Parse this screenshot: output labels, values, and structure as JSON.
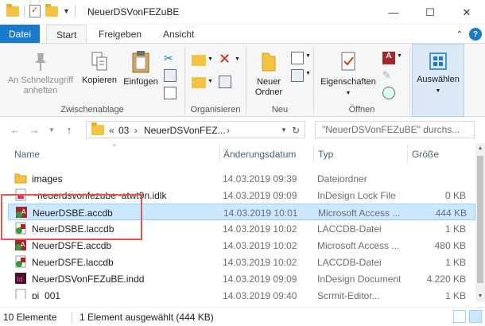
{
  "window": {
    "title": "NeuerDSVonFEZuBE",
    "minimize": "—",
    "maximize": "☐",
    "close": "✕"
  },
  "ribbon_tabs": [
    {
      "label": "Datei"
    },
    {
      "label": "Start",
      "active": true
    },
    {
      "label": "Freigeben"
    },
    {
      "label": "Ansicht"
    }
  ],
  "ribbon": {
    "zwischenablage": {
      "label": "Zwischenablage",
      "pin_label_1": "An Schnellzugriff",
      "pin_label_2": "anheften",
      "copy": "Kopieren",
      "paste": "Einfügen"
    },
    "organisieren": {
      "label": "Organisieren"
    },
    "neu": {
      "label": "Neu",
      "new_folder_1": "Neuer",
      "new_folder_2": "Ordner"
    },
    "oeffnen": {
      "label": "Öffnen",
      "properties": "Eigenschaften"
    },
    "auswaehlen": {
      "label": "Auswählen"
    }
  },
  "address": {
    "overflow": "«",
    "crumbs": [
      "03",
      "NeuerDSVonFEZ..."
    ],
    "separator": "›",
    "search_placeholder": "\"NeuerDSVonFEZuBE\" durchs..."
  },
  "columns": {
    "name": "Name",
    "date": "Änderungsdatum",
    "type": "Typ",
    "size": "Größe"
  },
  "files": [
    {
      "name": "images",
      "date": "14.03.2019 09:39",
      "type": "Dateiordner",
      "size": "",
      "icon": "folder"
    },
    {
      "name": "~neuerdsvonfezube~atwt9n.idlk",
      "date": "14.03.2019 09:09",
      "type": "InDesign Lock File",
      "size": "0 KB",
      "icon": "lock"
    },
    {
      "name": "NeuerDSBE.accdb",
      "date": "14.03.2019 10:01",
      "type": "Microsoft Access ...",
      "size": "444 KB",
      "icon": "access",
      "selected": true
    },
    {
      "name": "NeuerDSBE.laccdb",
      "date": "14.03.2019 10:02",
      "type": "LACCDB-Datei",
      "size": "1 KB",
      "icon": "laccdb"
    },
    {
      "name": "NeuerDSFE.accdb",
      "date": "14.03.2019 10:02",
      "type": "Microsoft Access ...",
      "size": "480 KB",
      "icon": "access"
    },
    {
      "name": "NeuerDSFE.laccdb",
      "date": "14.03.2019 10:02",
      "type": "LACCDB-Datei",
      "size": "1 KB",
      "icon": "laccdb"
    },
    {
      "name": "NeuerDSVonFEZuBE.indd",
      "date": "14.03.2019 09:09",
      "type": "InDesign Document",
      "size": "4.220 KB",
      "icon": "indd"
    },
    {
      "name": "pi_001",
      "date": "14.03.2019 09:40",
      "type": "Scrmit-Editor...",
      "size": "1 KB",
      "icon": "generic"
    }
  ],
  "status": {
    "count": "10 Elemente",
    "selection": "1 Element ausgewählt (444 KB)"
  },
  "colors": {
    "accent": "#1979ca",
    "selection": "#cce8ff",
    "annotation": "#e05a4f"
  }
}
